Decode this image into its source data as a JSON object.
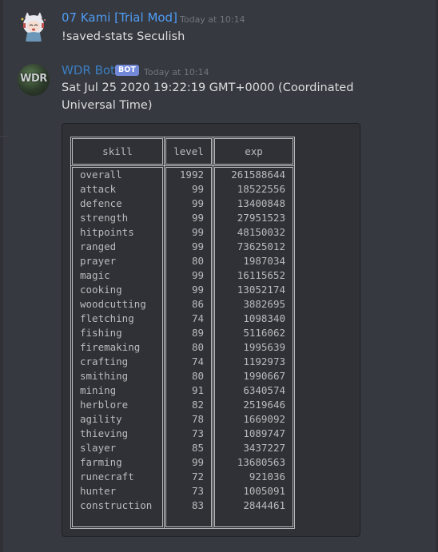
{
  "messages": [
    {
      "author": "07 Kami [Trial Mod]",
      "author_color": "#4f9cf5",
      "timestamp": "Today at 10:14",
      "content": "!saved-stats Seculish",
      "avatar": "anime-avatar-icon"
    },
    {
      "author": "WDR Bot",
      "author_color": "#3b7fc4",
      "bot_tag": "BOT",
      "timestamp": "Today at 10:14",
      "content": "Sat Jul 25 2020 19:22:19 GMT+0000 (Coordinated Universal Time)",
      "avatar_text": "WDR",
      "table": {
        "headers": [
          "skill",
          "level",
          "exp"
        ],
        "rows": [
          [
            "overall",
            "1992",
            "261588644"
          ],
          [
            "attack",
            "99",
            "18522556"
          ],
          [
            "defence",
            "99",
            "13400848"
          ],
          [
            "strength",
            "99",
            "27951523"
          ],
          [
            "hitpoints",
            "99",
            "48150032"
          ],
          [
            "ranged",
            "99",
            "73625012"
          ],
          [
            "prayer",
            "80",
            "1987034"
          ],
          [
            "magic",
            "99",
            "16115652"
          ],
          [
            "cooking",
            "99",
            "13052174"
          ],
          [
            "woodcutting",
            "86",
            "3882695"
          ],
          [
            "fletching",
            "74",
            "1098340"
          ],
          [
            "fishing",
            "89",
            "5116062"
          ],
          [
            "firemaking",
            "80",
            "1995639"
          ],
          [
            "crafting",
            "74",
            "1192973"
          ],
          [
            "smithing",
            "80",
            "1990667"
          ],
          [
            "mining",
            "91",
            "6340574"
          ],
          [
            "herblore",
            "82",
            "2519646"
          ],
          [
            "agility",
            "78",
            "1669092"
          ],
          [
            "thieving",
            "73",
            "1089747"
          ],
          [
            "slayer",
            "85",
            "3437227"
          ],
          [
            "farming",
            "99",
            "13680563"
          ],
          [
            "runecraft",
            "72",
            "921036"
          ],
          [
            "hunter",
            "73",
            "1005091"
          ],
          [
            "construction",
            "83",
            "2844461"
          ]
        ]
      }
    }
  ]
}
